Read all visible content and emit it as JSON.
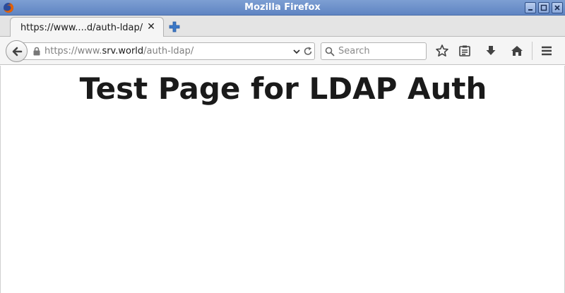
{
  "window": {
    "title": "Mozilla Firefox"
  },
  "tab": {
    "title": "https://www....d/auth-ldap/"
  },
  "navbar": {
    "url_prefix": "https://www.",
    "url_host": "srv.world",
    "url_path": "/auth-ldap/",
    "search_placeholder": "Search"
  },
  "page": {
    "heading": "Test Page for LDAP Auth"
  },
  "icons": {
    "app": "firefox-icon",
    "minimize": "minimize-icon",
    "maximize": "maximize-icon",
    "close": "close-icon",
    "new_tab": "plus-icon",
    "back": "back-arrow-icon",
    "lock": "lock-icon",
    "dropdown": "chevron-down-icon",
    "reload": "reload-icon",
    "search": "search-icon",
    "bookmark": "star-icon",
    "reading_list": "clipboard-icon",
    "downloads": "download-icon",
    "home": "home-icon",
    "menu": "hamburger-menu-icon"
  },
  "colors": {
    "titlebar": "#6e91cb",
    "text": "#1a1a1a",
    "url_dim": "#808080",
    "new_tab_plus": "#3b78c7"
  }
}
